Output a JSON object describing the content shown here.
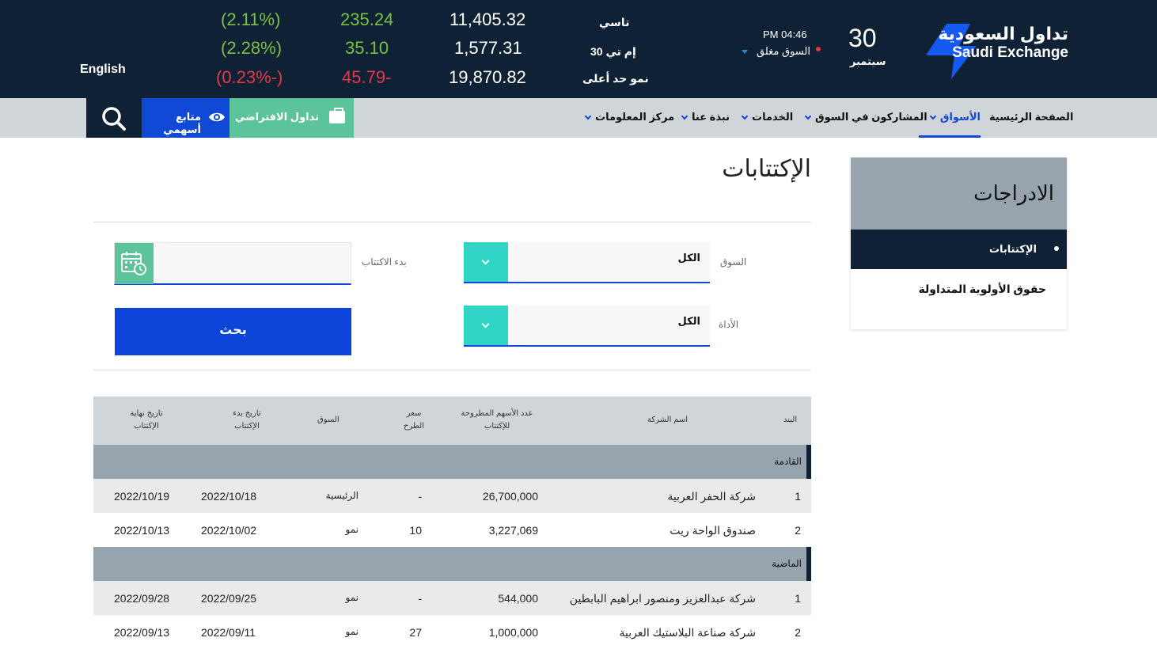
{
  "header": {
    "logo_ar": "تداول السعودية",
    "logo_en": "Saudi Exchange",
    "date_day": "30",
    "date_month": "سبتمبر",
    "market_time": "PM 04:46",
    "market_status": "السوق مغلق",
    "language": "English",
    "indices": [
      {
        "name": "تاسي",
        "value": "11,405.32",
        "change": "235.24",
        "percent": "(2.11%)",
        "direction": "up"
      },
      {
        "name": "إم تي 30",
        "value": "1,577.31",
        "change": "35.10",
        "percent": "(2.28%)",
        "direction": "up"
      },
      {
        "name": "نمو حد أعلى",
        "value": "19,870.82",
        "change": "45.79-",
        "percent": "(0.23%-)",
        "direction": "down"
      }
    ]
  },
  "nav": {
    "items": [
      "الصفحة الرئيسية",
      "الأسواق",
      "المشاركون في السوق",
      "الخدمات",
      "نبذة عنا",
      "مركز المعلومات"
    ],
    "virtual_trading": "تداول الافتراضي",
    "watchlist": "متابع أسهمي"
  },
  "sidebar": {
    "title": "الادراجات",
    "items": [
      "الإكتتابات",
      "حقوق الأولوية المتداولة"
    ]
  },
  "page": {
    "title": "الإكتتابات"
  },
  "filters": {
    "market_label": "السوق",
    "market_value": "الكل",
    "instrument_label": "الأداة",
    "instrument_value": "الكل",
    "start_label": "بدء الاكتتاب",
    "start_value": "",
    "search_label": "بحث"
  },
  "table": {
    "headers": {
      "index": "البند",
      "company": "اسم الشركة",
      "shares_line1": "عدد الأسهم المطروحة",
      "shares_line2": "للإكتتاب",
      "price_line1": "سعر",
      "price_line2": "الطرح",
      "market": "السوق",
      "start_line1": "تاريخ بدء",
      "start_line2": "الإكتتاب",
      "end_line1": "تاريخ نهاية",
      "end_line2": "الإكتتاب"
    },
    "groups": [
      {
        "label": "القادمة",
        "rows": [
          {
            "index": "1",
            "company": "شركة الحفر العربية",
            "shares": "26,700,000",
            "price": "-",
            "market": "الرئيسية",
            "start": "2022/10/18",
            "end": "2022/10/19"
          },
          {
            "index": "2",
            "company": "صندوق الواحة ريت",
            "shares": "3,227,069",
            "price": "10",
            "market": "نمو",
            "start": "2022/10/02",
            "end": "2022/10/13"
          }
        ]
      },
      {
        "label": "الماضية",
        "rows": [
          {
            "index": "1",
            "company": "شركة عبدالعزيز ومنصور ابراهيم البابطين",
            "shares": "544,000",
            "price": "-",
            "market": "نمو",
            "start": "2022/09/25",
            "end": "2022/09/28"
          },
          {
            "index": "2",
            "company": "شركة صناعة البلاستيك العربية",
            "shares": "1,000,000",
            "price": "27",
            "market": "نمو",
            "start": "2022/09/11",
            "end": "2022/09/13"
          }
        ]
      }
    ]
  }
}
